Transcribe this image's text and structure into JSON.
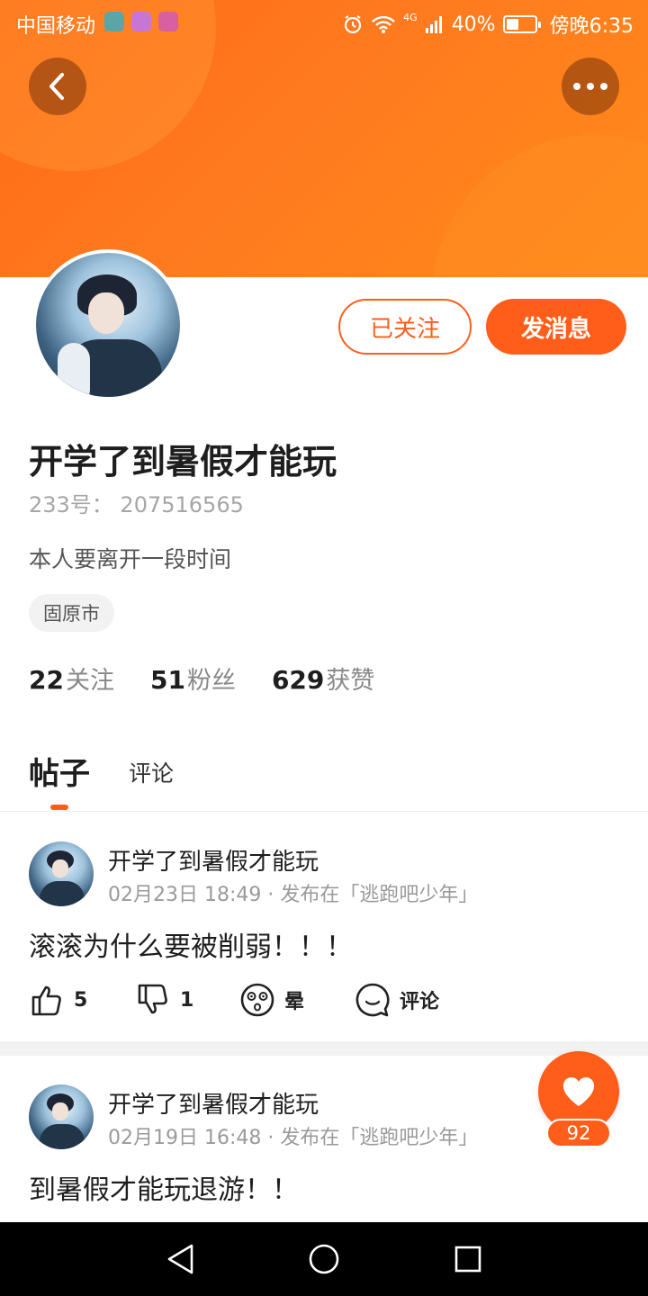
{
  "status_bar": {
    "carrier": "中国移动",
    "battery_percent": "40%",
    "time": "傍晚6:35",
    "network": "4G"
  },
  "header": {
    "back_icon": "chevron-left-icon",
    "more_icon": "more-horizontal-icon"
  },
  "profile": {
    "follow_button": "已关注",
    "message_button": "发消息",
    "username": "开学了到暑假才能玩",
    "user_id": "233号：  207516565",
    "bio": "本人要离开一段时间",
    "location": "固原市",
    "stats": [
      {
        "value": "22",
        "label": "关注"
      },
      {
        "value": "51",
        "label": "粉丝"
      },
      {
        "value": "629",
        "label": "获赞"
      }
    ]
  },
  "tabs": [
    {
      "label": "帖子",
      "active": true
    },
    {
      "label": "评论",
      "active": false
    }
  ],
  "posts": [
    {
      "author": "开学了到暑假才能玩",
      "meta": "02月23日 18:49 · 发布在「逃跑吧少年」",
      "text": "滚滚为什么要被削弱！！！",
      "actions": {
        "like": "5",
        "dislike": "1",
        "dizzy": "晕",
        "comment": "评论"
      }
    },
    {
      "author": "开学了到暑假才能玩",
      "meta": "02月19日 16:48 · 发布在「逃跑吧少年」",
      "text": "到暑假才能玩退游！！"
    }
  ],
  "floating_like": {
    "count": "92"
  },
  "colors": {
    "accent": "#ff5e1a",
    "header": "#ff7a1f"
  }
}
